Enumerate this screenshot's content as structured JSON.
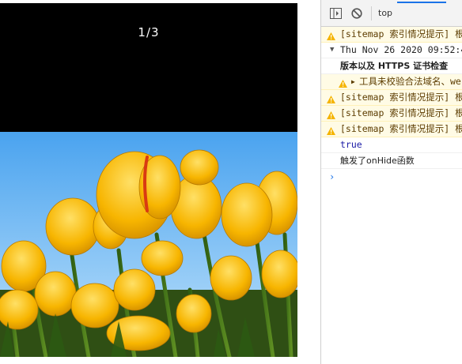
{
  "preview": {
    "page_indicator": "1/3"
  },
  "devtools": {
    "context": "top",
    "logs": [
      {
        "type": "warn",
        "text": "[sitemap 索引情况提示] 根"
      },
      {
        "type": "group",
        "text": "Thu Nov 26 2020 09:52:4"
      },
      {
        "type": "group-body",
        "text": "版本以及 HTTPS 证书检查"
      },
      {
        "type": "nested-warn",
        "text": "工具未校验合法域名、we"
      },
      {
        "type": "warn",
        "text": "[sitemap 索引情况提示] 根"
      },
      {
        "type": "warn",
        "text": "[sitemap 索引情况提示] 根"
      },
      {
        "type": "warn",
        "text": "[sitemap 索引情况提示] 根"
      },
      {
        "type": "bool",
        "text": "true"
      },
      {
        "type": "plain",
        "text": "触发了onHide函数"
      }
    ],
    "prompt": "›"
  },
  "colors": {
    "warn_background": "#fffbe5",
    "warn_icon": "#f5b400",
    "accent": "#1a73e8"
  }
}
